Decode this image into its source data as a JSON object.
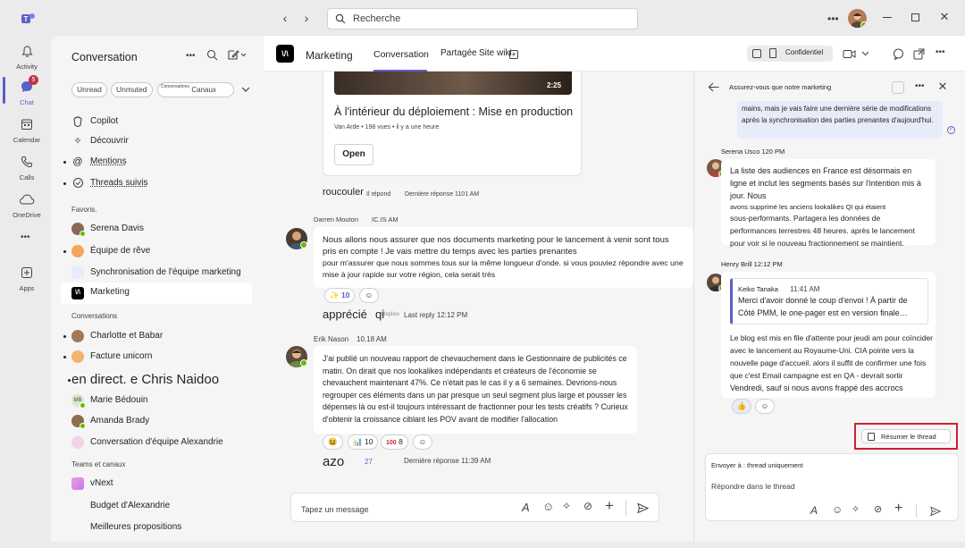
{
  "title_bar": {
    "search_placeholder": "Recherche"
  },
  "rail": {
    "items": [
      {
        "label": "Activity",
        "icon": "bell-icon"
      },
      {
        "label": "Chat",
        "icon": "chat-icon",
        "badge": "5"
      },
      {
        "label": "Calendar",
        "icon": "calendar-icon"
      },
      {
        "label": "Calls",
        "icon": "phone-icon"
      },
      {
        "label": "OneDrive",
        "icon": "cloud-icon"
      },
      {
        "label": "Apps",
        "icon": "apps-icon"
      }
    ]
  },
  "chatlist": {
    "title": "Conversation",
    "chips": [
      "Unread",
      "Unmuted",
      "Conversations",
      "Canaux"
    ],
    "top_items": [
      "Copilot",
      "Découvrir",
      "Mentions",
      "Threads suivis"
    ],
    "favorites_label": "Favoris.",
    "favorites": [
      "Serena Davis",
      "Équipe de rêve",
      "Synchronisation de l'équipe marketing",
      "Marketing"
    ],
    "conversations_label": "Conversations",
    "conversations": [
      "Charlotte et Babar",
      "Facture unicorn",
      "en direct. e Chris Naidoo",
      "Marie Bédouin",
      "Amanda Brady",
      "Conversation d'équipe Alexandrie"
    ],
    "teams_label": "Teams et canaux",
    "teams": [
      "vNext",
      "Budget d'Alexandrie",
      "Meilleures propositions"
    ]
  },
  "channel": {
    "name": "Marketing",
    "tabs": [
      "Conversation",
      "Partagée",
      "Site wiki"
    ],
    "sensitivity": "Confidentiel"
  },
  "messages": {
    "card": {
      "duration": "2:25",
      "title": "À l'intérieur du déploiement : Mise en production",
      "meta": "Van Arde • 198 vues • il y a une heure",
      "open_label": "Open",
      "reply_sender": "roucouler",
      "reply_count": "Il répond",
      "last_reply": "Dernière réponse 1101 AM"
    },
    "m1": {
      "sender": "Darren Mouton",
      "time": "IC.IS AM",
      "text1": "Nous allons nous assurer que nos documents marketing pour le lancement à venir sont tous pris en compte ! Je vais mettre du temps avec les parties prenantes",
      "text2": "pour m'assurer que nous sommes tous sur la même longueur d'onde. si vous pouviez répondre avec une mise à jour rapide sur votre région, cela serait très",
      "reaction": "10",
      "reply_word": "apprécié",
      "reply_suffix": "qi",
      "replies": "Replies",
      "last_reply": "Last reply 12:12 PM"
    },
    "m2": {
      "sender": "Erik Nason",
      "time": "10.18 AM",
      "text": "J'ai publié un nouveau rapport de chevauchement dans le Gestionnaire de publicités ce matin. On dirait que nos lookalikes indépendants et créateurs de l'économie se chevauchent maintenant 47%. Ce n'était pas le cas il y a 6 semaines. Devrions-nous regrouper ces éléments dans un par presque un seul segment plus large et pousser les dépenses là ou est-il toujours intéressant de fractionner pour les tests créatifs ? Curieux d'obtenir la croissance ciblant les POV avant de modifier l'allocation",
      "reaction1": "10",
      "reaction2": "8",
      "reply_word": "azo",
      "reply_count": "27",
      "last_reply": "Dernière réponse 11:39 AM"
    }
  },
  "compose": {
    "placeholder": "Tapez un message"
  },
  "thread": {
    "title": "Assurez-vous que notre marketing",
    "top_text": "mains, mais je vais faire une dernière série de modifications après la synchronisation des parties prenantes d'aujourd'hui.",
    "s1": {
      "sender": "Serena Usco 120 PM",
      "p1": "La liste des audiences en France est désormais en ligne et inclut les segments basés sur l'intention mis à jour. Nous",
      "p2": "avons supprimé les anciens lookalikes QI qui étaient",
      "p3": "sous-performants. Partagera les données de performances terrestres 48 heures. après le lancement pour voir si le nouveau fractionnement se maintient."
    },
    "s2": {
      "sender": "Henry Brill 12:12 PM",
      "quote_name": "Keiko Tanaka",
      "quote_time": "11:41 AM",
      "quote_text": "Merci d'avoir donné le coup d'envoi ! À partir de Côté PMM, le one-pager est en version finale…",
      "p1": "Le blog est mis en file d'attente pour jeudi am pour coïncider avec le lancement au Royaume-Uni. CIA pointe vers la nouvelle page d'accueil. alors il suffit de confirmer une fois que c'est Email campagne est en QA - devrait sortir",
      "p2": "Vendredi, sauf si nous avons frappé des accrocs"
    },
    "summarize_label": "Résumer le thread",
    "send_to": "Envoyer à : thread uniquement",
    "reply_placeholder": "Répondre dans le thread"
  },
  "colors": {
    "accent": "#5b5fc7",
    "highlight": "#d01f2f",
    "quote_bg": "#e8ebfa"
  }
}
